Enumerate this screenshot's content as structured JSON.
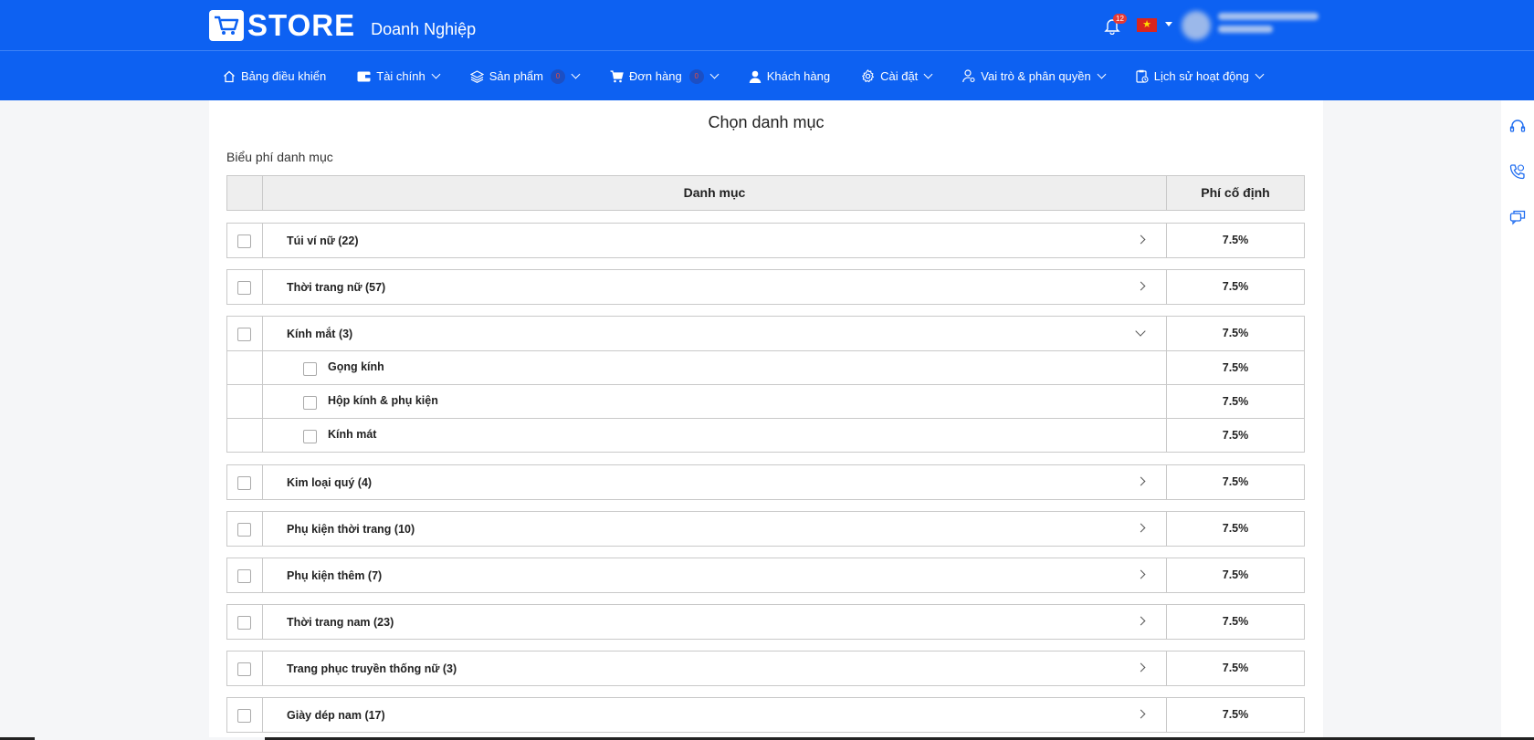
{
  "header": {
    "logo_text": "STORE",
    "logo_sub": "Doanh Nghiệp",
    "notification_count": "12",
    "language_flag": "★"
  },
  "nav": {
    "items": [
      {
        "label": "Bảng điều khiển",
        "icon": "home-icon"
      },
      {
        "label": "Tài chính",
        "icon": "wallet-icon",
        "dropdown": true
      },
      {
        "label": "Sản phẩm",
        "icon": "layers-icon",
        "badge": "0",
        "dropdown": true
      },
      {
        "label": "Đơn hàng",
        "icon": "cart-icon",
        "badge": "0",
        "dropdown": true
      },
      {
        "label": "Khách hàng",
        "icon": "user-icon"
      },
      {
        "label": "Cài đặt",
        "icon": "gear-icon",
        "dropdown": true
      },
      {
        "label": "Vai trò & phân quyền",
        "icon": "role-icon",
        "dropdown": true
      },
      {
        "label": "Lịch sử hoạt động",
        "icon": "history-icon",
        "dropdown": true
      }
    ]
  },
  "main": {
    "title": "Chọn danh mục",
    "section_label": "Biểu phí danh mục",
    "table": {
      "col_category": "Danh mục",
      "col_fee": "Phí cố định",
      "groups": [
        {
          "label": "Túi ví nữ (22)",
          "fee": "7.5%",
          "expanded": false
        },
        {
          "label": "Thời trang nữ (57)",
          "fee": "7.5%",
          "expanded": false
        },
        {
          "label": "Kính mắt (3)",
          "fee": "7.5%",
          "expanded": true,
          "children": [
            {
              "label": "Gọng kính",
              "fee": "7.5%"
            },
            {
              "label": "Hộp kính & phụ kiện",
              "fee": "7.5%"
            },
            {
              "label": "Kính mát",
              "fee": "7.5%"
            }
          ]
        },
        {
          "label": "Kim loại quý (4)",
          "fee": "7.5%",
          "expanded": false
        },
        {
          "label": "Phụ kiện thời trang (10)",
          "fee": "7.5%",
          "expanded": false
        },
        {
          "label": "Phụ kiện thêm (7)",
          "fee": "7.5%",
          "expanded": false
        },
        {
          "label": "Thời trang nam (23)",
          "fee": "7.5%",
          "expanded": false
        },
        {
          "label": "Trang phục truyền thống nữ (3)",
          "fee": "7.5%",
          "expanded": false
        },
        {
          "label": "Giày dép nam (17)",
          "fee": "7.5%",
          "expanded": false
        }
      ]
    }
  },
  "side_icons": [
    "headset-icon",
    "phone-call-icon",
    "chat-icon"
  ]
}
